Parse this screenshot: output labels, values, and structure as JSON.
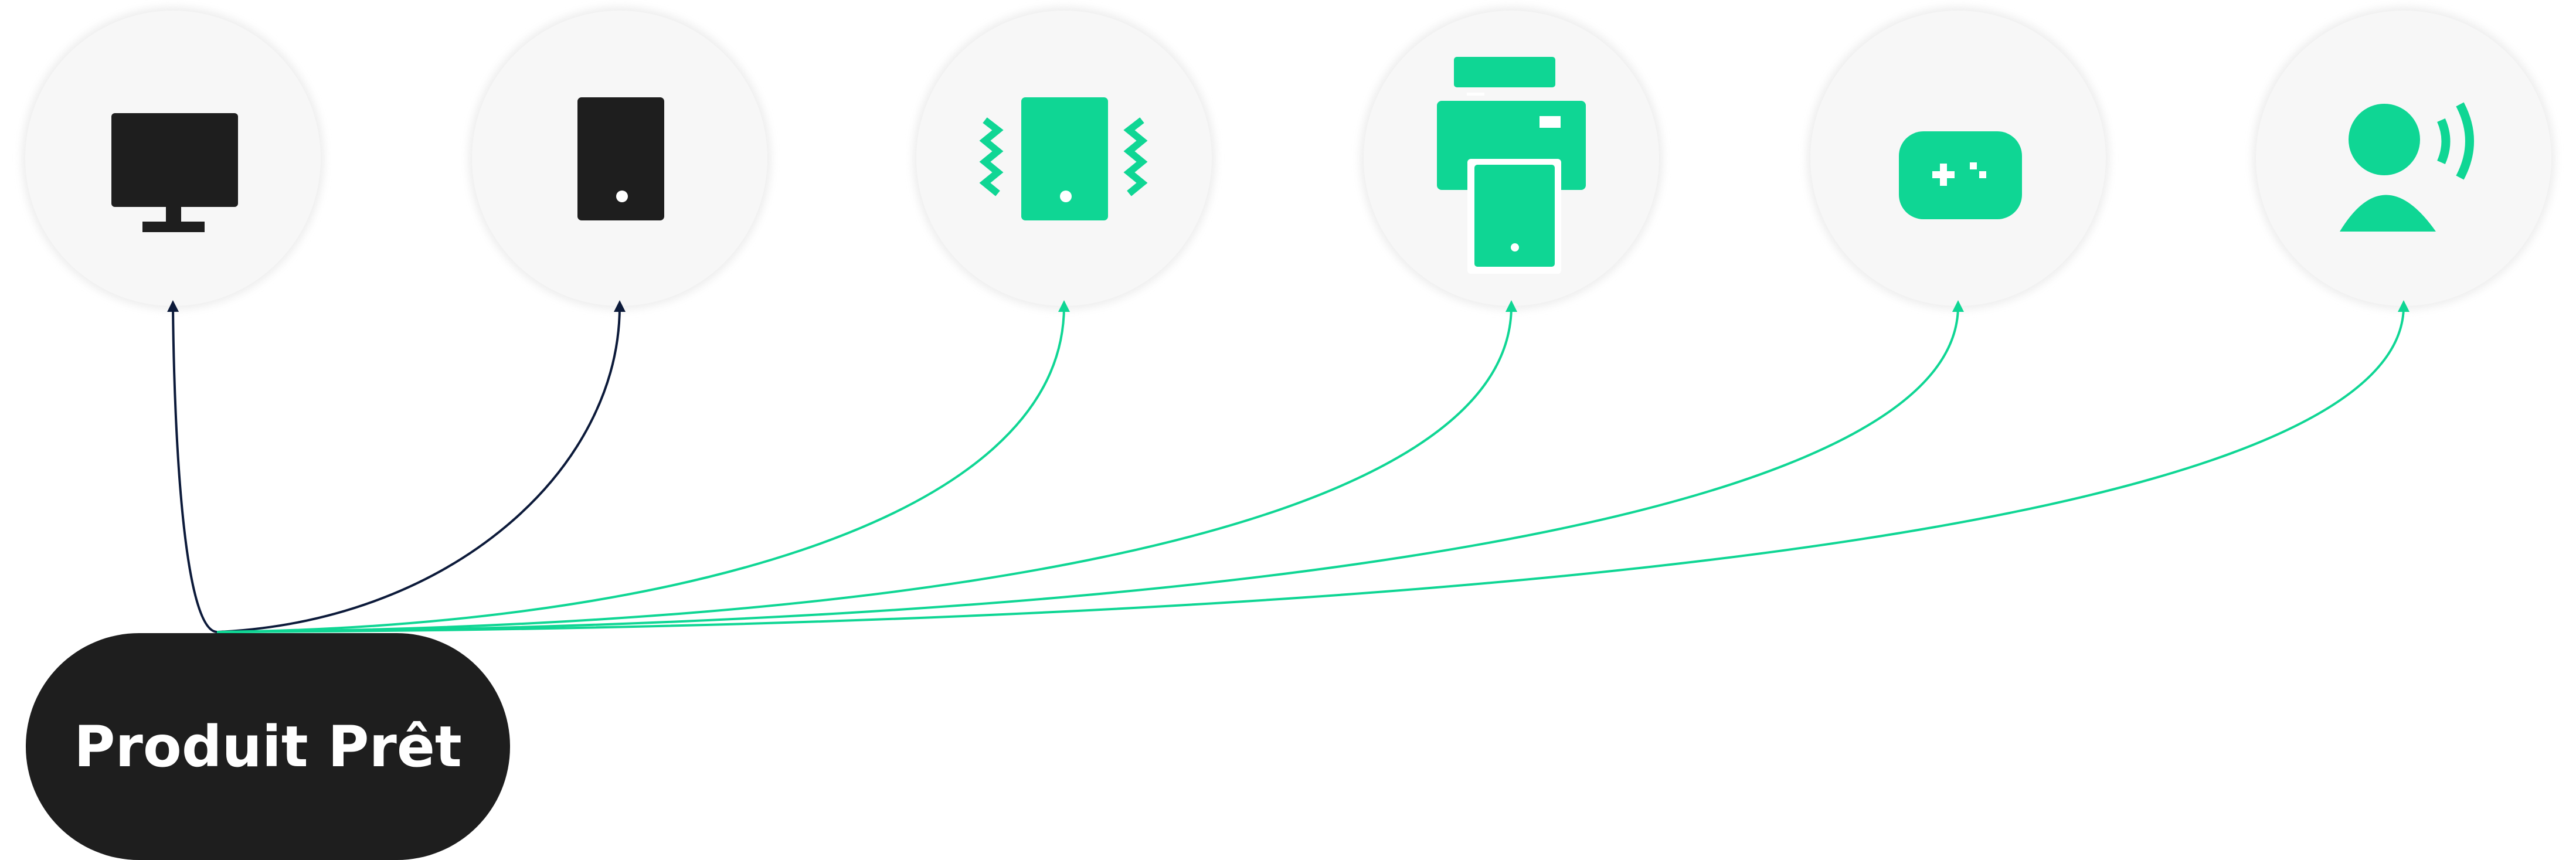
{
  "product": {
    "label": "Produit Prêt"
  },
  "colors": {
    "dark": "#1e1e1e",
    "accent": "#0fd694",
    "link_dark": "#0c1a3a",
    "circle_fill": "#f7f7f7"
  },
  "targets": [
    {
      "icon": "monitor-icon",
      "tone": "dark"
    },
    {
      "icon": "tablet-icon",
      "tone": "dark"
    },
    {
      "icon": "vibrating-phone-icon",
      "tone": "accent"
    },
    {
      "icon": "printer-icon",
      "tone": "accent"
    },
    {
      "icon": "gamepad-icon",
      "tone": "accent"
    },
    {
      "icon": "voice-assistant-icon",
      "tone": "accent"
    }
  ]
}
